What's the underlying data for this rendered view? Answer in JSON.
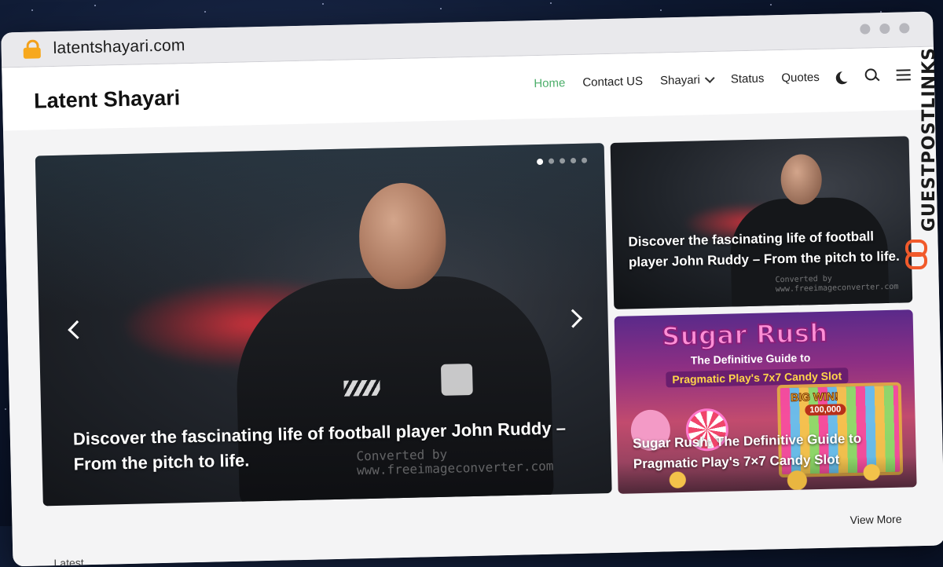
{
  "browser": {
    "url": "latentshayari.com"
  },
  "site": {
    "brand": "Latent Shayari",
    "nav": [
      {
        "label": "Home",
        "active": true
      },
      {
        "label": "Contact US",
        "active": false
      },
      {
        "label": "Shayari",
        "active": false,
        "dropdown": true
      },
      {
        "label": "Status",
        "active": false
      },
      {
        "label": "Quotes",
        "active": false
      }
    ],
    "nav_icons": [
      "moon-icon",
      "search-icon",
      "menu-icon"
    ],
    "accent_color": "#4cae6a"
  },
  "hero": {
    "title": "Discover the fascinating life of football player John Ruddy – From the pitch to life.",
    "watermark_line1": "Converted by",
    "watermark_line2": "www.freeimageconverter.com",
    "slides_count": 5,
    "active_slide": 1
  },
  "side_cards": [
    {
      "title": "Discover the fascinating life of football player John Ruddy – From the pitch to life.",
      "watermark_line1": "Converted by",
      "watermark_line2": "www.freeimageconverter.com"
    },
    {
      "title": "Sugar Rush: The Definitive Guide to Pragmatic Play's 7×7 Candy Slot",
      "image_text": {
        "banner": "Sugar Rush",
        "sub1": "The Definitive Guide to",
        "sub2": "Pragmatic Play's 7x7 Candy Slot",
        "bigwin": "BIG WIN!",
        "amount": "100,000"
      }
    }
  ],
  "footer": {
    "view_more": "View More",
    "section_label": "Latest"
  },
  "overlay": {
    "side_brand": "GUESTPOSTLINKS"
  }
}
